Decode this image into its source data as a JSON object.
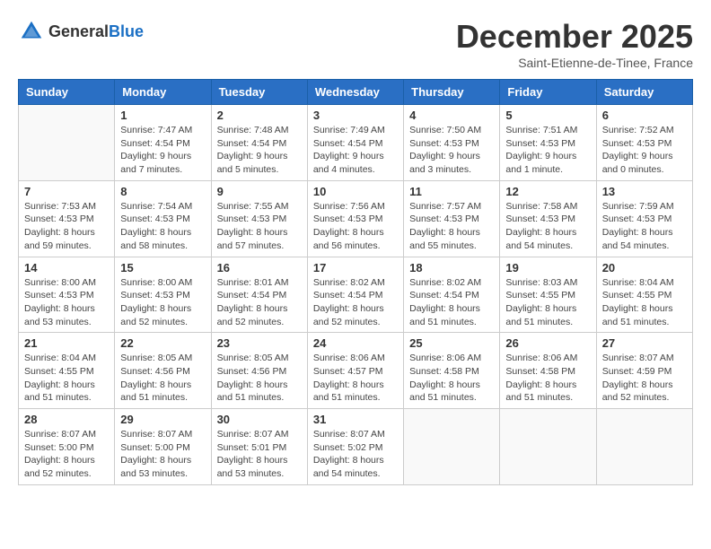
{
  "header": {
    "logo_general": "General",
    "logo_blue": "Blue",
    "month": "December 2025",
    "location": "Saint-Etienne-de-Tinee, France"
  },
  "weekdays": [
    "Sunday",
    "Monday",
    "Tuesday",
    "Wednesday",
    "Thursday",
    "Friday",
    "Saturday"
  ],
  "weeks": [
    [
      {
        "day": "",
        "info": ""
      },
      {
        "day": "1",
        "info": "Sunrise: 7:47 AM\nSunset: 4:54 PM\nDaylight: 9 hours\nand 7 minutes."
      },
      {
        "day": "2",
        "info": "Sunrise: 7:48 AM\nSunset: 4:54 PM\nDaylight: 9 hours\nand 5 minutes."
      },
      {
        "day": "3",
        "info": "Sunrise: 7:49 AM\nSunset: 4:54 PM\nDaylight: 9 hours\nand 4 minutes."
      },
      {
        "day": "4",
        "info": "Sunrise: 7:50 AM\nSunset: 4:53 PM\nDaylight: 9 hours\nand 3 minutes."
      },
      {
        "day": "5",
        "info": "Sunrise: 7:51 AM\nSunset: 4:53 PM\nDaylight: 9 hours\nand 1 minute."
      },
      {
        "day": "6",
        "info": "Sunrise: 7:52 AM\nSunset: 4:53 PM\nDaylight: 9 hours\nand 0 minutes."
      }
    ],
    [
      {
        "day": "7",
        "info": "Sunrise: 7:53 AM\nSunset: 4:53 PM\nDaylight: 8 hours\nand 59 minutes."
      },
      {
        "day": "8",
        "info": "Sunrise: 7:54 AM\nSunset: 4:53 PM\nDaylight: 8 hours\nand 58 minutes."
      },
      {
        "day": "9",
        "info": "Sunrise: 7:55 AM\nSunset: 4:53 PM\nDaylight: 8 hours\nand 57 minutes."
      },
      {
        "day": "10",
        "info": "Sunrise: 7:56 AM\nSunset: 4:53 PM\nDaylight: 8 hours\nand 56 minutes."
      },
      {
        "day": "11",
        "info": "Sunrise: 7:57 AM\nSunset: 4:53 PM\nDaylight: 8 hours\nand 55 minutes."
      },
      {
        "day": "12",
        "info": "Sunrise: 7:58 AM\nSunset: 4:53 PM\nDaylight: 8 hours\nand 54 minutes."
      },
      {
        "day": "13",
        "info": "Sunrise: 7:59 AM\nSunset: 4:53 PM\nDaylight: 8 hours\nand 54 minutes."
      }
    ],
    [
      {
        "day": "14",
        "info": "Sunrise: 8:00 AM\nSunset: 4:53 PM\nDaylight: 8 hours\nand 53 minutes."
      },
      {
        "day": "15",
        "info": "Sunrise: 8:00 AM\nSunset: 4:53 PM\nDaylight: 8 hours\nand 52 minutes."
      },
      {
        "day": "16",
        "info": "Sunrise: 8:01 AM\nSunset: 4:54 PM\nDaylight: 8 hours\nand 52 minutes."
      },
      {
        "day": "17",
        "info": "Sunrise: 8:02 AM\nSunset: 4:54 PM\nDaylight: 8 hours\nand 52 minutes."
      },
      {
        "day": "18",
        "info": "Sunrise: 8:02 AM\nSunset: 4:54 PM\nDaylight: 8 hours\nand 51 minutes."
      },
      {
        "day": "19",
        "info": "Sunrise: 8:03 AM\nSunset: 4:55 PM\nDaylight: 8 hours\nand 51 minutes."
      },
      {
        "day": "20",
        "info": "Sunrise: 8:04 AM\nSunset: 4:55 PM\nDaylight: 8 hours\nand 51 minutes."
      }
    ],
    [
      {
        "day": "21",
        "info": "Sunrise: 8:04 AM\nSunset: 4:55 PM\nDaylight: 8 hours\nand 51 minutes."
      },
      {
        "day": "22",
        "info": "Sunrise: 8:05 AM\nSunset: 4:56 PM\nDaylight: 8 hours\nand 51 minutes."
      },
      {
        "day": "23",
        "info": "Sunrise: 8:05 AM\nSunset: 4:56 PM\nDaylight: 8 hours\nand 51 minutes."
      },
      {
        "day": "24",
        "info": "Sunrise: 8:06 AM\nSunset: 4:57 PM\nDaylight: 8 hours\nand 51 minutes."
      },
      {
        "day": "25",
        "info": "Sunrise: 8:06 AM\nSunset: 4:58 PM\nDaylight: 8 hours\nand 51 minutes."
      },
      {
        "day": "26",
        "info": "Sunrise: 8:06 AM\nSunset: 4:58 PM\nDaylight: 8 hours\nand 51 minutes."
      },
      {
        "day": "27",
        "info": "Sunrise: 8:07 AM\nSunset: 4:59 PM\nDaylight: 8 hours\nand 52 minutes."
      }
    ],
    [
      {
        "day": "28",
        "info": "Sunrise: 8:07 AM\nSunset: 5:00 PM\nDaylight: 8 hours\nand 52 minutes."
      },
      {
        "day": "29",
        "info": "Sunrise: 8:07 AM\nSunset: 5:00 PM\nDaylight: 8 hours\nand 53 minutes."
      },
      {
        "day": "30",
        "info": "Sunrise: 8:07 AM\nSunset: 5:01 PM\nDaylight: 8 hours\nand 53 minutes."
      },
      {
        "day": "31",
        "info": "Sunrise: 8:07 AM\nSunset: 5:02 PM\nDaylight: 8 hours\nand 54 minutes."
      },
      {
        "day": "",
        "info": ""
      },
      {
        "day": "",
        "info": ""
      },
      {
        "day": "",
        "info": ""
      }
    ]
  ]
}
